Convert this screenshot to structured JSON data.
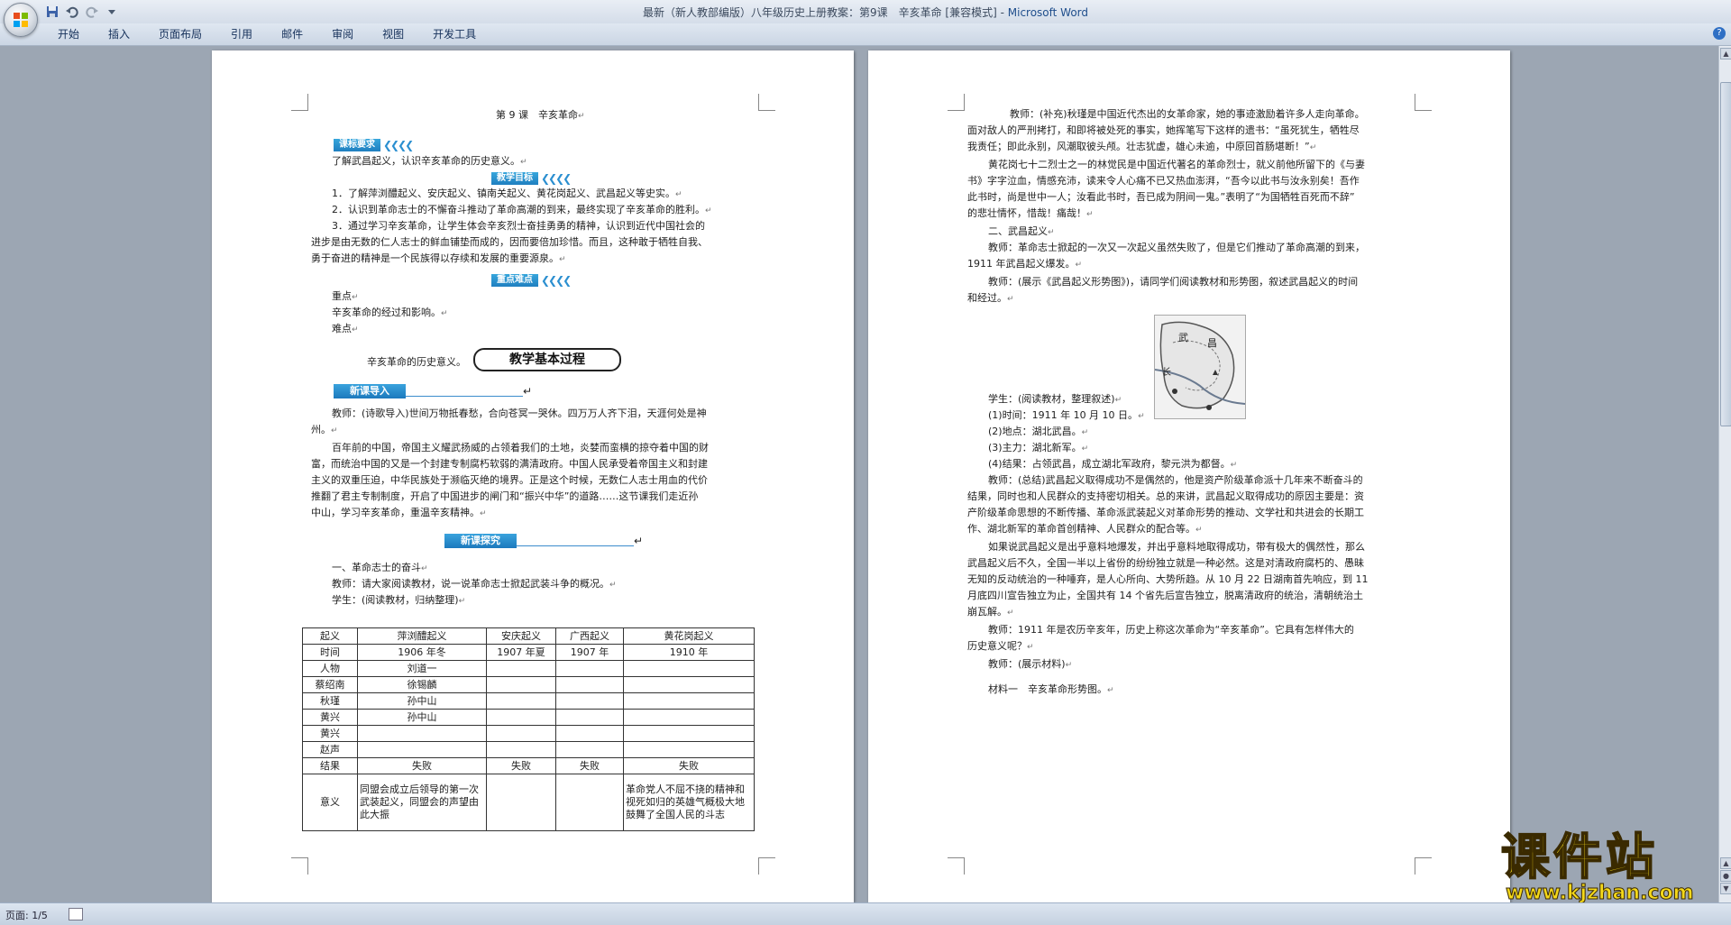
{
  "window": {
    "title": "最新（新人教部编版）八年级历史上册教案：第9课　辛亥革命 [兼容模式] - ",
    "app_name": "Microsoft Word"
  },
  "ribbon": {
    "tabs": [
      "开始",
      "插入",
      "页面布局",
      "引用",
      "邮件",
      "审阅",
      "视图",
      "开发工具"
    ]
  },
  "status": {
    "page": "页面: 1/5"
  },
  "left_page": {
    "title": "第 9 课　辛亥革命",
    "banner_requirements": "课标要求",
    "req_text": "了解武昌起义，认识辛亥革命的历史意义。",
    "banner_goals": "教学目标",
    "goal1": "1．了解萍浏醴起义、安庆起义、镇南关起义、黄花岗起义、武昌起义等史实。",
    "goal2": "2．认识到革命志士的不懈奋斗推动了革命高潮的到来，最终实现了辛亥革命的胜利。",
    "goal3_l1": "3．通过学习辛亥革命，让学生体会辛亥烈士奋挂勇勇的精神，认识到近代中国社会的",
    "goal3_l2": "进步是由无数的仁人志士的鲜血铺垫而成的，因而要倍加珍惜。而且，这种敢于牺牲自我、",
    "goal3_l3": "勇于奋进的精神是一个民族得以存续和发展的重要源泉。",
    "banner_key": "重点难点",
    "key_label": "重点",
    "key_text": "辛亥革命的经过和影响。",
    "diff_label": "难点",
    "diff_text": "辛亥革命的历史意义。",
    "process_banner": "教学基本过程",
    "banner_intro": "新课导入",
    "intro_l1": "教师：(诗歌导入)世间万物抵春愁，合向苍冥一哭休。四万万人齐下泪，天涯何处是神",
    "intro_l2": "州。",
    "intro_p2_l1": "百年前的中国，帝国主义耀武扬威的占领着我们的土地，炎婪而蛮横的掠夺着中国的财",
    "intro_p2_l2": "富，而统治中国的又是一个封建专制腐朽软弱的满清政府。中国人民承受着帝国主义和封建",
    "intro_p2_l3": "主义的双重压迫，中华民族处于濒临灭绝的境界。正是这个时候，无数仁人志士用血的代价",
    "intro_p2_l4": "推翻了君主专制制度，开启了中国进步的闸门和“振兴中华”的道路……这节课我们走近孙",
    "intro_p2_l5": "中山，学习辛亥革命，重温辛亥精神。",
    "banner_explore": "新课探究",
    "sec1": "一、革命志士的奋斗",
    "sec1_t1": "教师：请大家阅读教材，说一说革命志士掀起武装斗争的概况。",
    "sec1_t2": "学生：(阅读教材，归纳整理)",
    "table": {
      "header": [
        "起义",
        "萍浏醴起义",
        "安庆起义",
        "广西起义",
        "黄花岗起义"
      ],
      "rows": [
        [
          "时间",
          "1906 年冬",
          "1907 年夏",
          "1907 年",
          "1910 年"
        ],
        [
          "人物",
          "刘道一",
          "",
          "",
          ""
        ],
        [
          "蔡绍南",
          "徐锡麟",
          "",
          "",
          ""
        ],
        [
          "秋瑾",
          "孙中山",
          "",
          "",
          ""
        ],
        [
          "黄兴",
          "孙中山",
          "",
          "",
          ""
        ],
        [
          "黄兴",
          "",
          "",
          "",
          ""
        ],
        [
          "赵声",
          "",
          "",
          "",
          ""
        ],
        [
          "结果",
          "失败",
          "失败",
          "失败",
          "失败"
        ]
      ],
      "last_row_label": "意义",
      "last_row_c1": "同盟会成立后领导的第一次武装起义，同盟会的声望由此大振",
      "last_row_c4": "革命党人不屈不挠的精神和视死如归的英雄气概极大地鼓舞了全国人民的斗志"
    }
  },
  "right_page": {
    "p1_l1": "教师：(补充)秋瑾是中国近代杰出的女革命家，她的事迹激励着许多人走向革命。",
    "p1_l2": "面对敌人的严刑拷打，和即将被处死的事实，她挥笔写下这样的遗书：“虽死犹生，牺牲尽",
    "p1_l3": "我责任；即此永别，风潮取彼头颅。壮志犹虚，雄心未逾，中原回首肠堪断！”",
    "p2_l1": "黄花岗七十二烈士之一的林觉民是中国近代著名的革命烈士，就义前他所留下的《与妻",
    "p2_l2": "书》字字泣血，情感充沛，读来令人心痛不已又热血澎湃，“吾今以此书与汝永别矣！吾作",
    "p2_l3": "此书时，尚是世中一人；汝看此书时，吾已成为阴间一鬼。”表明了“为国牺牲百死而不辞”",
    "p2_l4": "的悲壮情怀，惜哉！痛哉！",
    "sec2": "二、武昌起义",
    "p3_l1": "教师：革命志士掀起的一次又一次起义虽然失败了，但是它们推动了革命高潮的到来，",
    "p3_l2": "1911 年武昌起义爆发。",
    "p4_l1": "教师：(展示《武昌起义形势图》)，请同学们阅读教材和形势图，叙述武昌起义的时间",
    "p4_l2": "和经过。",
    "map_label_1": "武",
    "map_label_2": "昌",
    "map_label_3": "长",
    "p5": "学生：(阅读教材，整理叙述)",
    "item1": "(1)时间：1911 年 10 月 10 日。",
    "item2": "(2)地点：湖北武昌。",
    "item3": "(3)主力：湖北新军。",
    "item4": "(4)结果：占领武昌，成立湖北军政府，黎元洪为都督。",
    "p6_l1": "教师：(总结)武昌起义取得成功不是偶然的，他是资产阶级革命派十几年来不断奋斗的",
    "p6_l2": "结果，同时也和人民群众的支持密切相关。总的来讲，武昌起义取得成功的原因主要是：资",
    "p6_l3": "产阶级革命思想的不断传播、革命派武装起义对革命形势的推动、文学社和共进会的长期工",
    "p6_l4": "作、湖北新军的革命首创精神、人民群众的配合等。",
    "p7_l1": "如果说武昌起义是出乎意料地爆发，并出乎意料地取得成功，带有极大的偶然性，那么",
    "p7_l2": "武昌起义后不久，全国一半以上省份的纷纷独立就是一种必然。这是对清政府腐朽的、愚昧",
    "p7_l3": "无知的反动统治的一种唾弃，是人心所向、大势所趋。从 10 月 22 日湖南首先响应，到 11",
    "p7_l4": "月底四川宣告独立为止，全国共有 14 个省先后宣告独立，脱离清政府的统治，清朝统治土",
    "p7_l5": "崩瓦解。",
    "p8_l1": "教师：1911 年是农历辛亥年，历史上称这次革命为“辛亥革命”。它具有怎样伟大的",
    "p8_l2": "历史意义呢？",
    "p9": "教师：(展示材料)",
    "p10": "材料一　辛亥革命形势图。"
  },
  "watermark": {
    "text": "课件站",
    "url": "www.kjzhan.com"
  },
  "colors": {
    "banner_blue": "#1f7fc0",
    "watermark_yellow": "#f4d81a"
  }
}
